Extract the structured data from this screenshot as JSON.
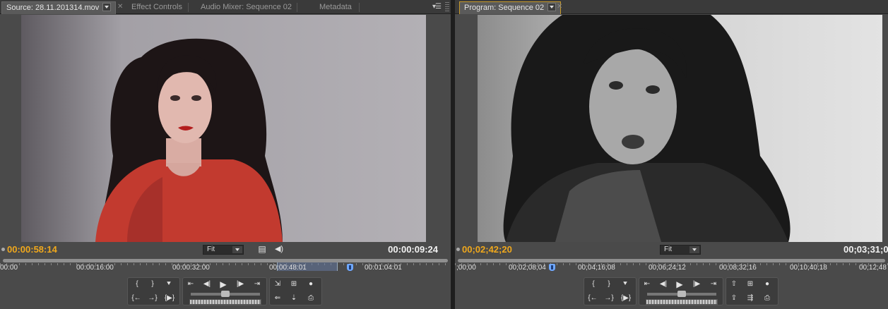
{
  "source_panel": {
    "tabs": [
      {
        "label": "Source: 28.11.201314.mov",
        "active": true
      },
      {
        "label": "Effect Controls",
        "active": false
      },
      {
        "label": "Audio Mixer: Sequence 02",
        "active": false
      },
      {
        "label": "Metadata",
        "active": false
      }
    ],
    "current_timecode": "00:00:58:14",
    "duration_timecode": "00:00:09:24",
    "zoom": "Fit",
    "ruler_labels": [
      "00:00",
      "00:00:16:00",
      "00:00:32:00",
      "00:00:48:01",
      "00:01:04:01"
    ],
    "playhead_fraction": 0.78
  },
  "program_panel": {
    "tabs": [
      {
        "label": "Program: Sequence 02",
        "active": true
      }
    ],
    "current_timecode": "00;02;42;20",
    "duration_timecode": "00;03;31;0",
    "zoom": "Fit",
    "ruler_labels": [
      ";00;00",
      "00;02;08;04",
      "00;04;16;08",
      "00;06;24;12",
      "00;08;32;16",
      "00;10;40;18",
      "00;12;48"
    ],
    "playhead_fraction": 0.22
  },
  "controls": {
    "mark_in": "{",
    "mark_out": "}",
    "add_marker": "⯆",
    "go_to_in": "{←",
    "go_to_out": "→}",
    "play_in_to_out": "{▶}",
    "step_back": "◀|",
    "play": "▶",
    "step_forward": "|▶",
    "insert": "⇐",
    "overwrite": "⇣",
    "lift": "⇧",
    "extract": "⇪"
  },
  "colors": {
    "timecode_current": "#f0a81c",
    "timecode_duration": "#f2f2f2",
    "panel_bg": "#4a4a4a",
    "active_panel_border": "#c89a2a"
  }
}
